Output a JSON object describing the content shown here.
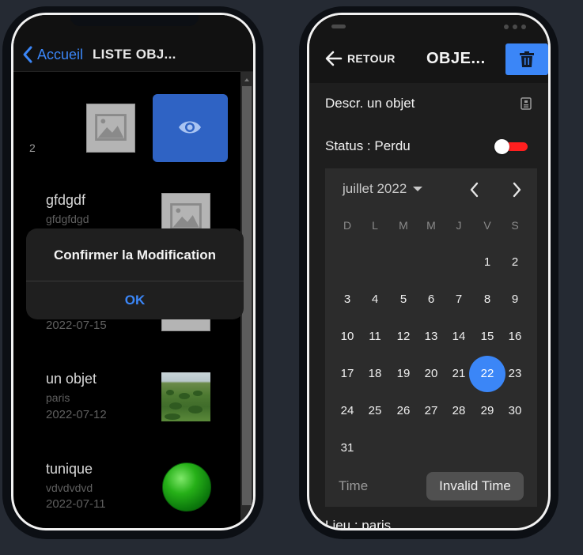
{
  "left_screen": {
    "header": {
      "back_label": "Accueil",
      "title": "LISTE OBJ..."
    },
    "partial_row": {
      "number": "2"
    },
    "items": [
      {
        "title": "gfdgdf",
        "subtitle": "gfdgfdgd",
        "date": "2022-07-15"
      },
      {
        "title": "un objet",
        "subtitle": "paris",
        "date": "2022-07-12"
      },
      {
        "title": "tunique",
        "subtitle": "vdvdvdvd",
        "date": "2022-07-11"
      }
    ],
    "dialog": {
      "title": "Confirmer la Modification",
      "ok_label": "OK"
    }
  },
  "right_screen": {
    "header": {
      "back_label": "RETOUR",
      "title": "OBJE..."
    },
    "description": "Descr.  un objet",
    "status": "Status : Perdu",
    "status_toggle_on": false,
    "calendar": {
      "month_label": "juillet 2022",
      "weekdays": [
        "D",
        "L",
        "M",
        "M",
        "J",
        "V",
        "S"
      ],
      "first_weekday_index": 5,
      "days_in_month": 31,
      "selected_day": 22,
      "time_label": "Time",
      "time_value": "Invalid Time"
    },
    "location": "Lieu :  paris"
  },
  "colors": {
    "accent_blue": "#3b86f7",
    "eye_button": "#2f63c4",
    "toggle_red": "#ff1f1f",
    "background": "#252a33"
  },
  "icons": {
    "back": "chevron-left-icon",
    "view": "eye-icon",
    "placeholder": "image-placeholder-icon",
    "retour": "arrow-left-icon",
    "delete": "trash-icon",
    "description": "document-icon",
    "prev_month": "chevron-left-icon",
    "next_month": "chevron-right-icon"
  }
}
